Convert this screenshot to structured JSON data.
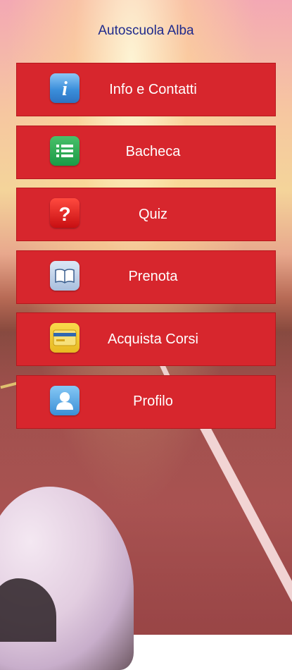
{
  "header": {
    "title": "Autoscuola Alba"
  },
  "menu": {
    "items": [
      {
        "label": "Info e Contatti",
        "icon": "info-icon"
      },
      {
        "label": "Bacheca",
        "icon": "list-icon"
      },
      {
        "label": "Quiz",
        "icon": "question-icon"
      },
      {
        "label": "Prenota",
        "icon": "book-icon"
      },
      {
        "label": "Acquista Corsi",
        "icon": "card-icon"
      },
      {
        "label": "Profilo",
        "icon": "user-icon"
      }
    ]
  },
  "colors": {
    "button_red": "#d7262d",
    "title_blue": "#1f2a8c"
  }
}
